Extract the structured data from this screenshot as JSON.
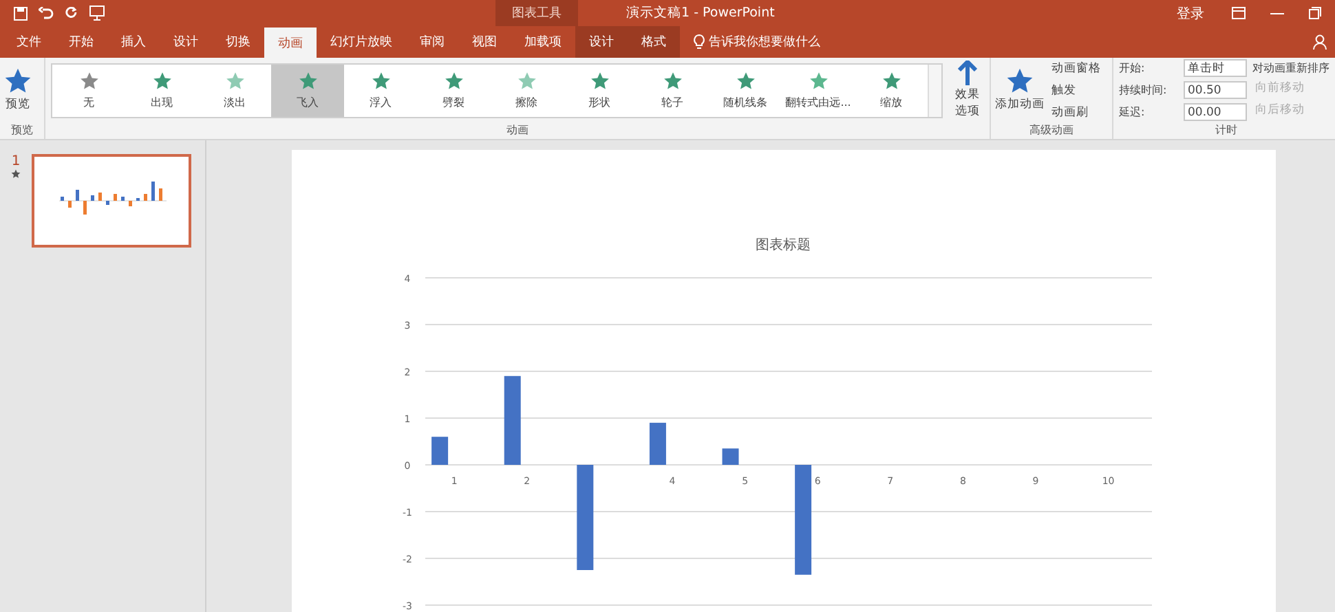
{
  "title_bar": {
    "quick_access": [
      {
        "kind": "save"
      },
      {
        "kind": "undo"
      },
      {
        "kind": "redo"
      },
      {
        "kind": "present"
      }
    ],
    "context_group": "图表工具",
    "title": "演示文稿1 - PowerPoint",
    "sign_in": "登录"
  },
  "tabs": [
    {
      "label": "文件",
      "selected": false,
      "contextual": false
    },
    {
      "label": "开始",
      "selected": false,
      "contextual": false
    },
    {
      "label": "插入",
      "selected": false,
      "contextual": false
    },
    {
      "label": "设计",
      "selected": false,
      "contextual": false
    },
    {
      "label": "切换",
      "selected": false,
      "contextual": false
    },
    {
      "label": "动画",
      "selected": true,
      "contextual": false
    },
    {
      "label": "幻灯片放映",
      "selected": false,
      "contextual": false
    },
    {
      "label": "审阅",
      "selected": false,
      "contextual": false
    },
    {
      "label": "视图",
      "selected": false,
      "contextual": false
    },
    {
      "label": "加载项",
      "selected": false,
      "contextual": false
    },
    {
      "label": "设计",
      "selected": false,
      "contextual": true
    },
    {
      "label": "格式",
      "selected": false,
      "contextual": true
    }
  ],
  "tell_me": {
    "placeholder": "告诉我你想要做什么"
  },
  "ribbon": {
    "preview": {
      "button": "预览",
      "group": "预览"
    },
    "animations": {
      "group": "动画",
      "items": [
        {
          "label": "无",
          "selected": false
        },
        {
          "label": "出现",
          "selected": false
        },
        {
          "label": "淡出",
          "selected": false
        },
        {
          "label": "飞入",
          "selected": true
        },
        {
          "label": "浮入",
          "selected": false
        },
        {
          "label": "劈裂",
          "selected": false
        },
        {
          "label": "擦除",
          "selected": false
        },
        {
          "label": "形状",
          "selected": false
        },
        {
          "label": "轮子",
          "selected": false
        },
        {
          "label": "随机线条",
          "selected": false
        },
        {
          "label": "翻转式由远...",
          "selected": false
        },
        {
          "label": "缩放",
          "selected": false
        }
      ],
      "effect_options": "效果选项"
    },
    "advanced": {
      "group": "高级动画",
      "add": "添加动画",
      "pane": "动画窗格",
      "trigger": "触发",
      "painter": "动画刷"
    },
    "timing": {
      "group": "计时",
      "start_label": "开始:",
      "start_value": "单击时",
      "duration_label": "持续时间:",
      "duration_value": "00.50",
      "delay_label": "延迟:",
      "delay_value": "00.00",
      "reorder": "对动画重新排序",
      "move_earlier": "向前移动",
      "move_later": "向后移动",
      "move_disabled": true
    }
  },
  "slides": [
    {
      "number": "1",
      "animated": true,
      "selected": true
    }
  ],
  "chart_data": {
    "type": "bar",
    "title": "图表标题",
    "x": [
      0.8,
      1.8,
      2.8,
      3.8,
      4.8,
      5.8
    ],
    "values": [
      0.6,
      1.9,
      -2.25,
      0.9,
      0.35,
      -2.35
    ],
    "xticks": [
      1,
      2,
      4,
      5,
      6,
      7,
      8,
      9,
      10
    ],
    "xlim": [
      0.6,
      10.6
    ],
    "yticks": [
      -3,
      -2,
      -1,
      0,
      1,
      2,
      3,
      4
    ],
    "ylim": [
      -3,
      4
    ],
    "grid": true
  }
}
